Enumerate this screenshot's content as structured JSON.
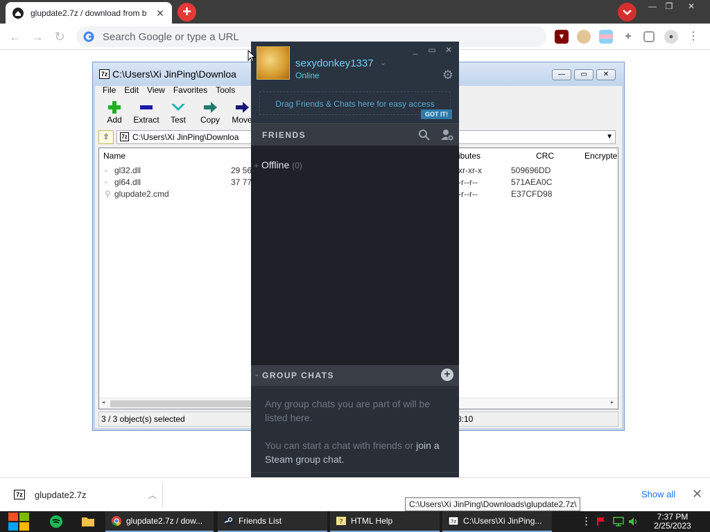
{
  "browser": {
    "tab_title": "glupdate2.7z / download from b",
    "omnibox_placeholder": "Search Google or type a URL",
    "colors": {
      "tabbar": "#3c3c3c",
      "new_tab": "#e53935"
    }
  },
  "zip": {
    "title": "C:\\Users\\Xi JinPing\\Downloa",
    "menu": [
      "File",
      "Edit",
      "View",
      "Favorites",
      "Tools"
    ],
    "toolbar": [
      "Add",
      "Extract",
      "Test",
      "Copy",
      "Move"
    ],
    "path": "C:\\Users\\Xi JinPing\\Downloa",
    "columns": {
      "name": "Name",
      "attributes": "ributes",
      "crc": "CRC",
      "encrypted": "Encrypte"
    },
    "rows": [
      {
        "name": "gl32.dll",
        "size": "29 56",
        "attributes": "xr-xr-x",
        "crc": "509696DD"
      },
      {
        "name": "gl64.dll",
        "size": "37 77",
        "attributes": "-r--r--",
        "crc": "571AEA0C"
      },
      {
        "name": "glupdate2.cmd",
        "size": "",
        "attributes": "-r--r--",
        "crc": "E37CFD98"
      }
    ],
    "status_left": "3 / 3 object(s) selected",
    "status_right": "8:10"
  },
  "steam": {
    "username": "sexydonkey1337",
    "status": "Online",
    "drag_hint": "Drag Friends & Chats here for easy access",
    "got_it": "GOT IT!",
    "friends_label": "FRIENDS",
    "offline_label": "Offline",
    "offline_count": "(0)",
    "group_chats_label": "GROUP CHATS",
    "gc_text_1": "Any group chats you are part of will be listed here.",
    "gc_text_2a": "You can start a chat with friends or ",
    "gc_text_2b": "join a Steam group chat.",
    "colors": {
      "bg": "#1e2128",
      "accent": "#6dcff6"
    }
  },
  "downloads": {
    "item_name": "glupdate2.7z",
    "show_all": "Show all",
    "tooltip": "C:\\Users\\Xi JinPing\\Downloads\\glupdate2.7z\\"
  },
  "taskbar": {
    "items": [
      "glupdate2.7z / dow...",
      "Friends List",
      "HTML Help",
      "C:\\Users\\Xi JinPing..."
    ],
    "time": "7:37 PM",
    "date": "2/25/2023"
  }
}
